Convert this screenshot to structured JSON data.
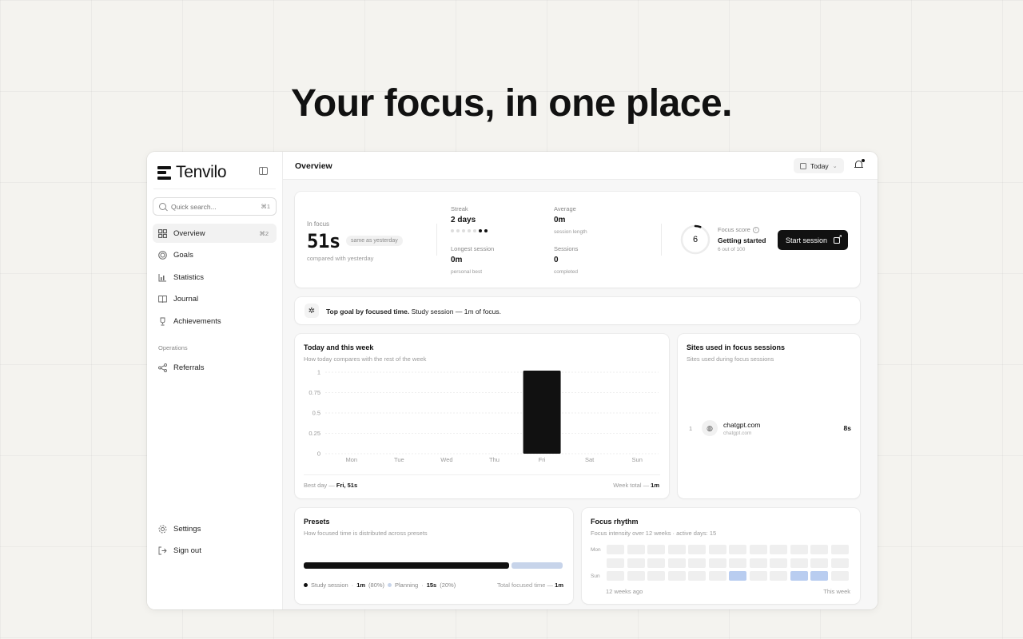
{
  "headline": "Your focus, in one place.",
  "brand": {
    "name": "Tenvilo"
  },
  "sidebar": {
    "search_placeholder": "Quick search...",
    "search_kbd": "⌘1",
    "items": [
      {
        "label": "Overview",
        "kbd": "⌘2",
        "icon": "grid-icon",
        "active": true
      },
      {
        "label": "Goals",
        "icon": "target-icon"
      },
      {
        "label": "Statistics",
        "icon": "bar-chart-icon"
      },
      {
        "label": "Journal",
        "icon": "book-icon"
      },
      {
        "label": "Achievements",
        "icon": "trophy-icon"
      }
    ],
    "section_label": "Operations",
    "ops_items": [
      {
        "label": "Referrals",
        "icon": "share-icon"
      }
    ],
    "bottom_items": [
      {
        "label": "Settings",
        "icon": "gear-icon"
      },
      {
        "label": "Sign out",
        "icon": "sign-out-icon"
      }
    ]
  },
  "topbar": {
    "title": "Overview",
    "date_label": "Today"
  },
  "summary": {
    "in_focus_label": "In focus",
    "in_focus_value": "51s",
    "pill": "same as yesterday",
    "compared": "compared with yesterday",
    "streak_label": "Streak",
    "streak_value": "2 days",
    "streak_dots": [
      false,
      false,
      false,
      false,
      false,
      true,
      true
    ],
    "average_label": "Average",
    "average_value": "0m",
    "average_sub": "session length",
    "longest_label": "Longest session",
    "longest_value": "0m",
    "longest_sub": "personal best",
    "sessions_label": "Sessions",
    "sessions_value": "0",
    "sessions_sub": "completed",
    "score_value": "6",
    "score_fraction": 0.06,
    "score_label": "Focus score",
    "score_status": "Getting started",
    "score_sub": "6 out of 100",
    "start_button": "Start session"
  },
  "top_goal": {
    "bold": "Top goal by focused time.",
    "text": " Study session — 1m of focus."
  },
  "week_chart": {
    "title": "Today and this week",
    "subtitle": "How today compares with the rest of the week",
    "best_label": "Best day — ",
    "best_value": "Fri, 51s",
    "total_label": "Week total — ",
    "total_value": "1m"
  },
  "chart_data": {
    "type": "bar",
    "title": "Today and this week",
    "categories": [
      "Mon",
      "Tue",
      "Wed",
      "Thu",
      "Fri",
      "Sat",
      "Sun"
    ],
    "values": [
      0,
      0,
      0,
      0,
      1,
      0,
      0
    ],
    "yticks": [
      "0",
      "0.25",
      "0.5",
      "0.75",
      "1"
    ],
    "ylim": [
      0,
      1
    ],
    "grid": true,
    "bar_color": "#111111"
  },
  "sites": {
    "title": "Sites used in focus sessions",
    "subtitle": "Sites used during focus sessions",
    "rows": [
      {
        "index": "1",
        "name": "chatgpt.com",
        "domain": "chatgpt.com",
        "time": "8s"
      }
    ]
  },
  "presets": {
    "title": "Presets",
    "subtitle": "How focused time is distributed across presets",
    "items": [
      {
        "name": "Study session",
        "value": "1m",
        "pct": "(80%)",
        "fraction": 0.8,
        "color": "#111111"
      },
      {
        "name": "Planning",
        "value": "15s",
        "pct": "(20%)",
        "fraction": 0.2,
        "color": "#c7d4ea"
      }
    ],
    "total_label": "Total focused time — ",
    "total_value": "1m"
  },
  "rhythm": {
    "title": "Focus rhythm",
    "subtitle": "Focus intensity over 12 weeks · active days: 15",
    "row_labels": [
      "Mon",
      "",
      "Sun"
    ],
    "start_label": "12 weeks ago",
    "end_label": "This week",
    "rows": [
      [
        0,
        0,
        0,
        0,
        0,
        0,
        0,
        0,
        0,
        0,
        0,
        0
      ],
      [
        0,
        0,
        0,
        0,
        0,
        0,
        0,
        0,
        0,
        0,
        0,
        0
      ],
      [
        0,
        0,
        0,
        0,
        0,
        0,
        2,
        0,
        0,
        2,
        2,
        0
      ]
    ],
    "colors": {
      "empty": "#efefef",
      "low": "#dfe7f5",
      "high": "#b9cdf0"
    }
  }
}
